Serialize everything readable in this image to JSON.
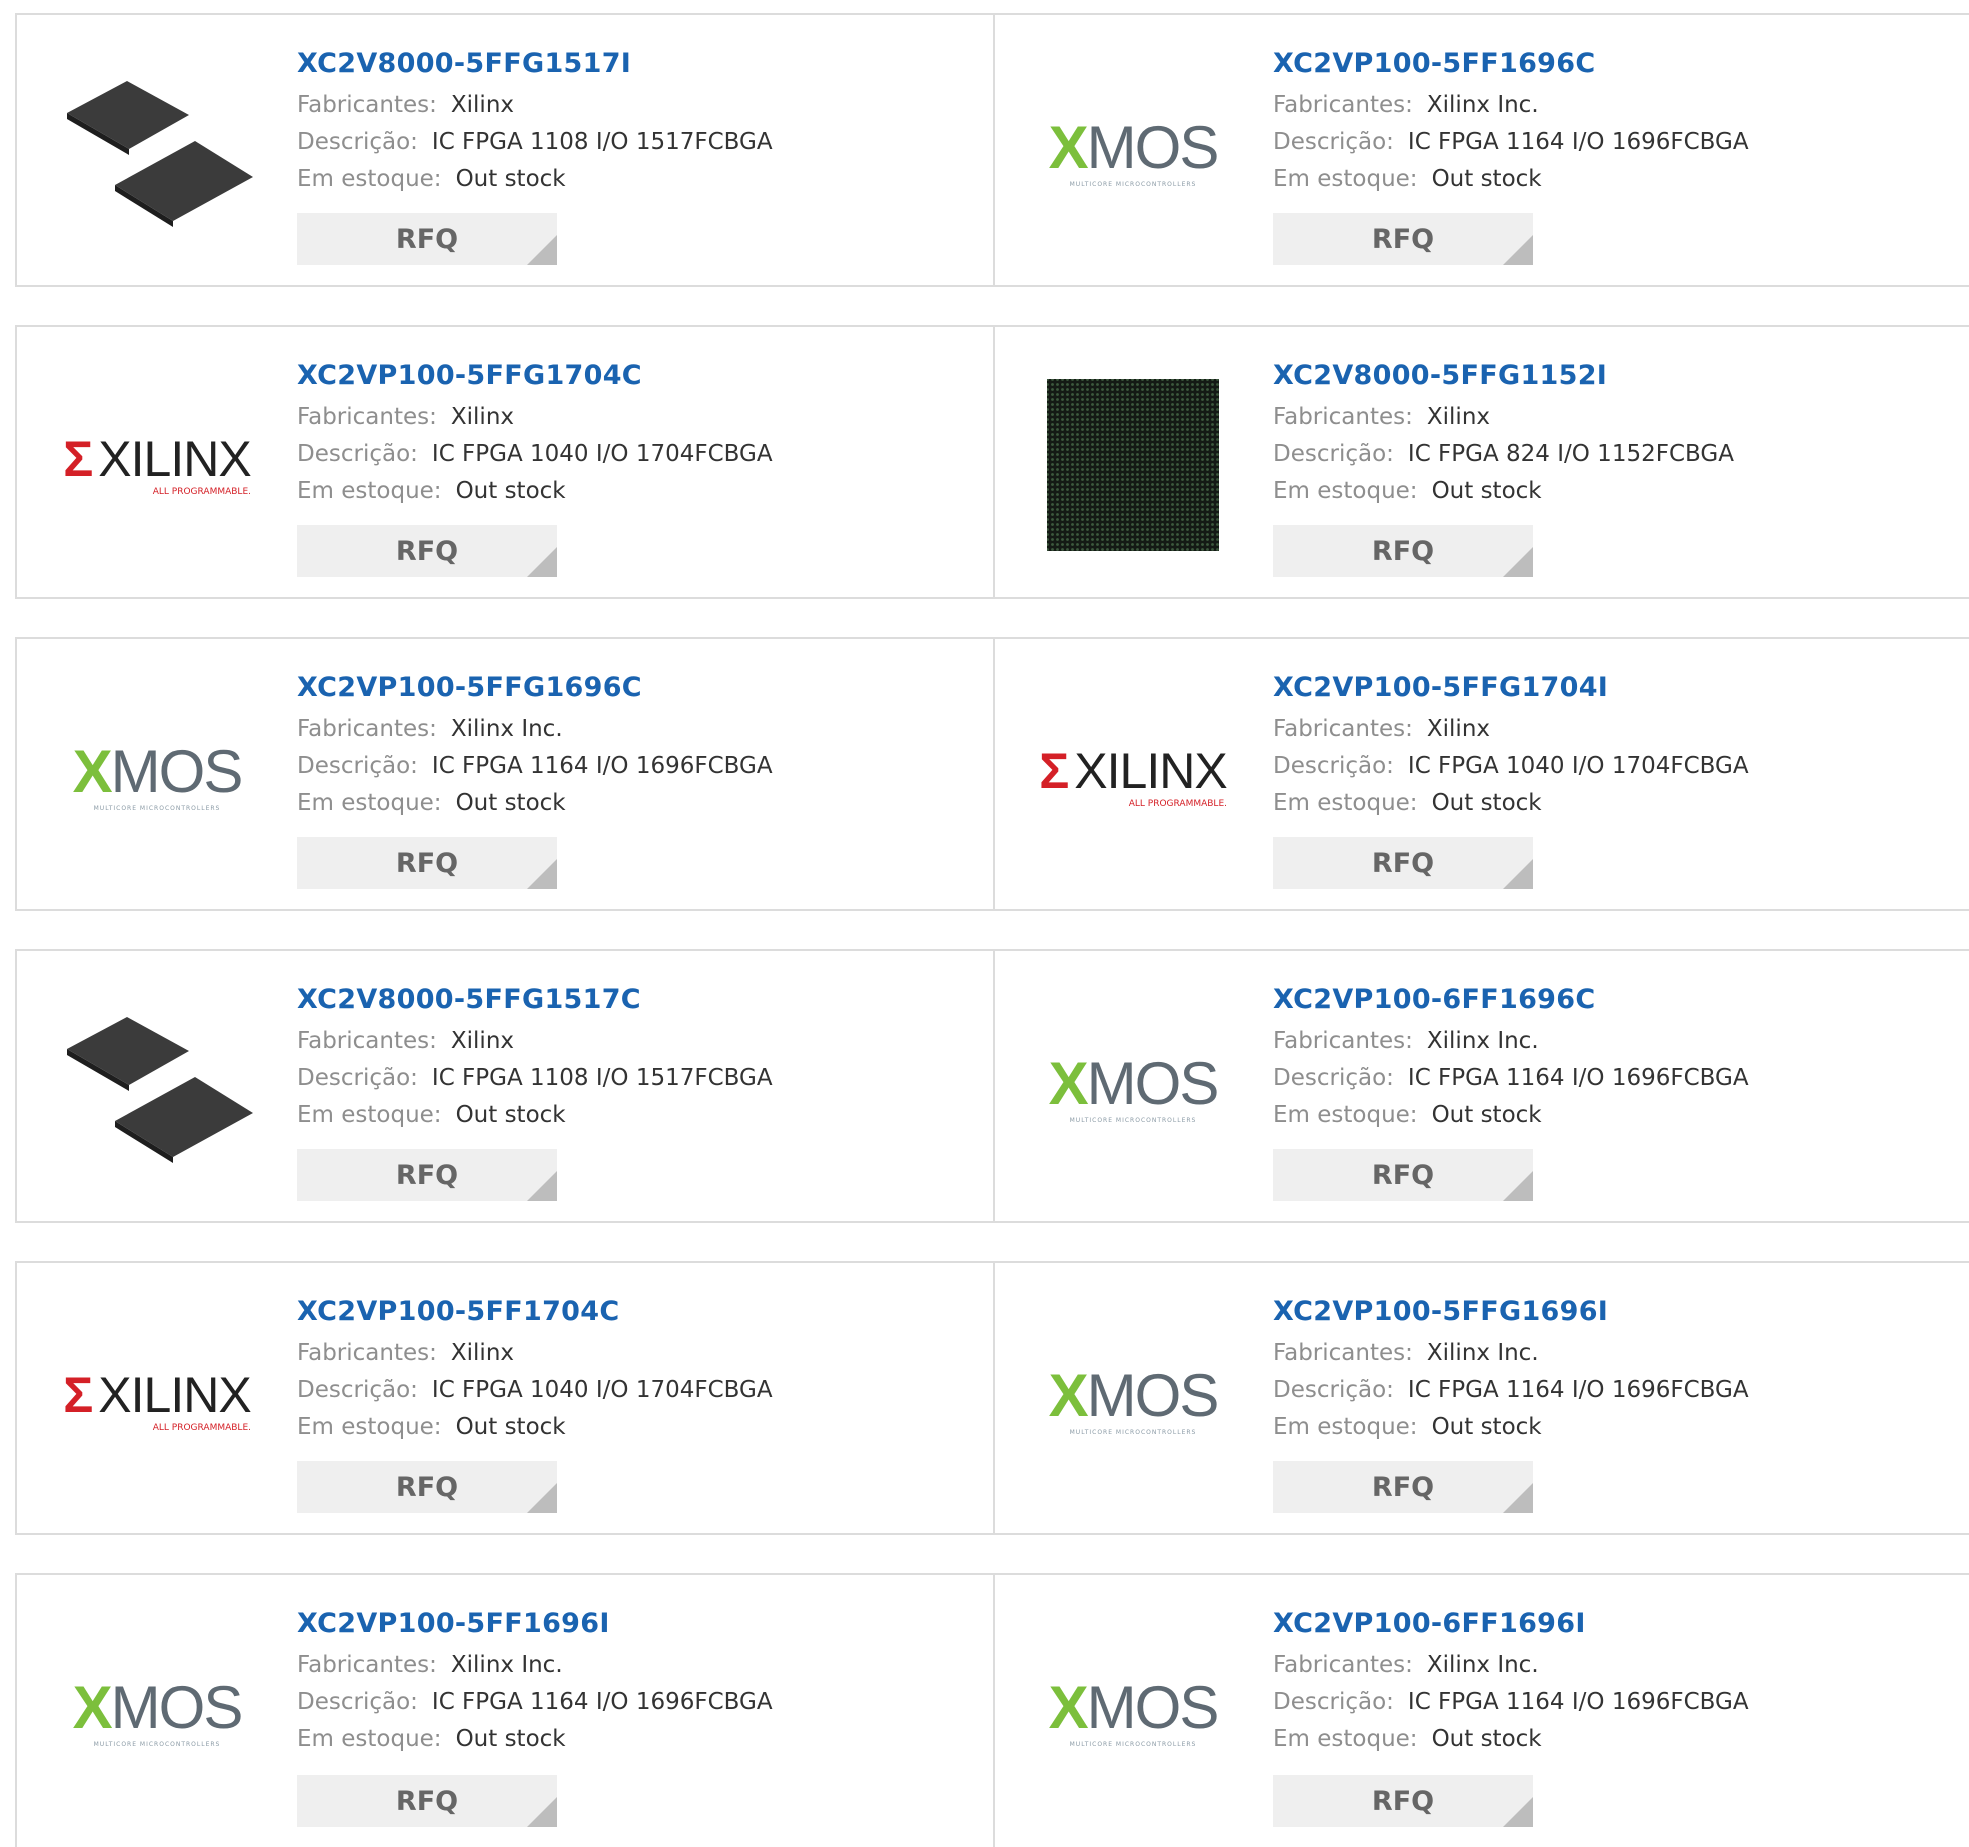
{
  "labels": {
    "manufacturer": "Fabricantes:",
    "description": "Descrição:",
    "stock": "Em estoque:",
    "rfq": "RFQ"
  },
  "logos": {
    "xmos": {
      "word": "MOS",
      "mark": "X",
      "tagline": "MULTICORE MICROCONTROLLERS"
    },
    "xilinx": {
      "word": "XILINX",
      "mark": "Σ",
      "tagline": "ALL PROGRAMMABLE."
    }
  },
  "colors": {
    "title": "#1a63b0",
    "label": "#8e8e8e",
    "value": "#333333",
    "rfq_bg": "#efefef",
    "border": "#dcdcdc"
  },
  "products": [
    {
      "part": "XC2V8000-5FFG1517I",
      "manufacturer": "Xilinx",
      "description": "IC FPGA 1108 I/O 1517FCBGA",
      "stock": "Out stock",
      "image": "two-chips"
    },
    {
      "part": "XC2VP100-5FF1696C",
      "manufacturer": "Xilinx Inc.",
      "description": "IC FPGA 1164 I/O 1696FCBGA",
      "stock": "Out stock",
      "image": "xmos"
    },
    {
      "part": "XC2VP100-5FFG1704C",
      "manufacturer": "Xilinx",
      "description": "IC FPGA 1040 I/O 1704FCBGA",
      "stock": "Out stock",
      "image": "xilinx"
    },
    {
      "part": "XC2V8000-5FFG1152I",
      "manufacturer": "Xilinx",
      "description": "IC FPGA 824 I/O 1152FCBGA",
      "stock": "Out stock",
      "image": "bga-chip"
    },
    {
      "part": "XC2VP100-5FFG1696C",
      "manufacturer": "Xilinx Inc.",
      "description": "IC FPGA 1164 I/O 1696FCBGA",
      "stock": "Out stock",
      "image": "xmos"
    },
    {
      "part": "XC2VP100-5FFG1704I",
      "manufacturer": "Xilinx",
      "description": "IC FPGA 1040 I/O 1704FCBGA",
      "stock": "Out stock",
      "image": "xilinx"
    },
    {
      "part": "XC2V8000-5FFG1517C",
      "manufacturer": "Xilinx",
      "description": "IC FPGA 1108 I/O 1517FCBGA",
      "stock": "Out stock",
      "image": "two-chips"
    },
    {
      "part": "XC2VP100-6FF1696C",
      "manufacturer": "Xilinx Inc.",
      "description": "IC FPGA 1164 I/O 1696FCBGA",
      "stock": "Out stock",
      "image": "xmos"
    },
    {
      "part": "XC2VP100-5FF1704C",
      "manufacturer": "Xilinx",
      "description": "IC FPGA 1040 I/O 1704FCBGA",
      "stock": "Out stock",
      "image": "xilinx"
    },
    {
      "part": "XC2VP100-5FFG1696I",
      "manufacturer": "Xilinx Inc.",
      "description": "IC FPGA 1164 I/O 1696FCBGA",
      "stock": "Out stock",
      "image": "xmos"
    },
    {
      "part": "XC2VP100-5FF1696I",
      "manufacturer": "Xilinx Inc.",
      "description": "IC FPGA 1164 I/O 1696FCBGA",
      "stock": "Out stock",
      "image": "xmos"
    },
    {
      "part": "XC2VP100-6FF1696I",
      "manufacturer": "Xilinx Inc.",
      "description": "IC FPGA 1164 I/O 1696FCBGA",
      "stock": "Out stock",
      "image": "xmos"
    }
  ]
}
